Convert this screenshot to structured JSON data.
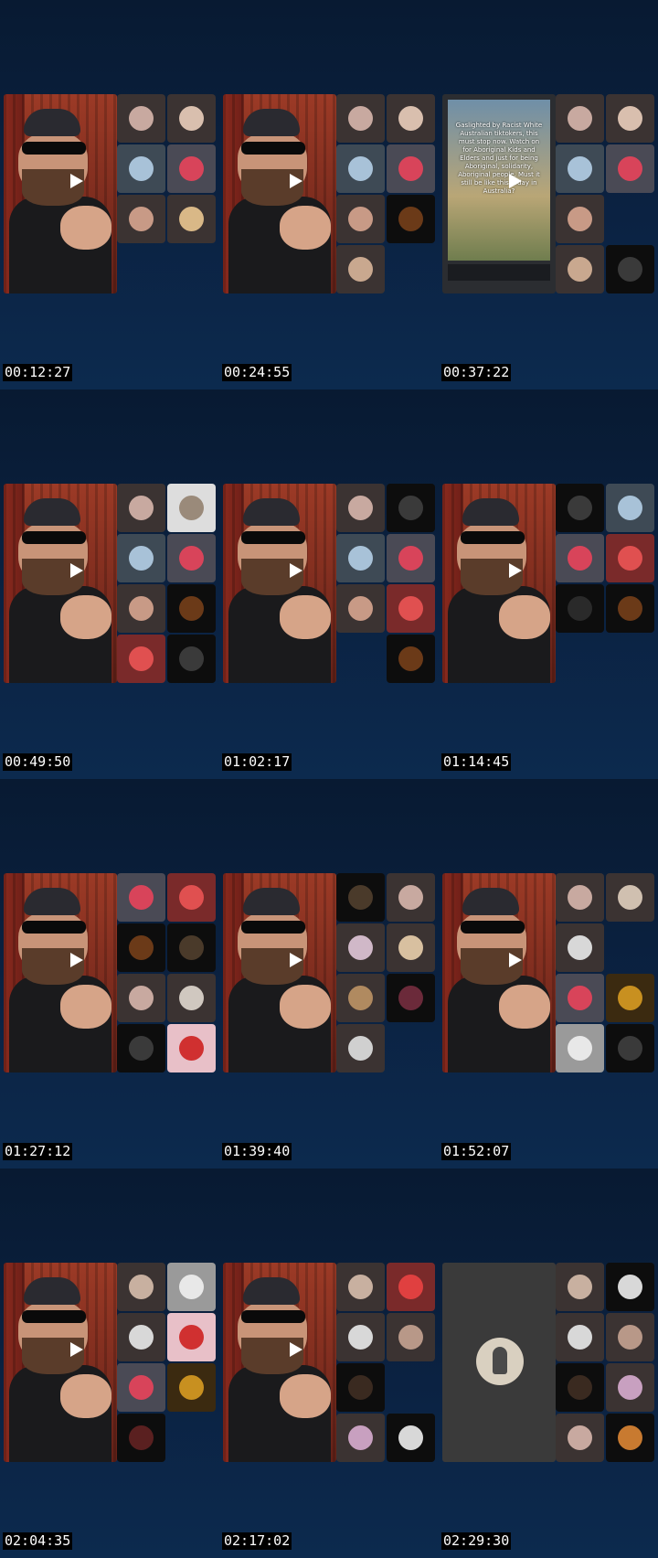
{
  "rows": [
    {
      "frames": [
        {
          "timestamp": "00:12:27",
          "main": "video",
          "tiles": [
            [
              "#3b3332",
              "#c8a9a0"
            ],
            [
              "#3b3332",
              "#d9bfae"
            ],
            [
              "#3e4a55",
              "#a8c2d8"
            ],
            [
              "#4a4a55",
              "#d8445a"
            ],
            [
              "#3b3332",
              "#c89a86"
            ],
            [
              "#3b3332",
              "#d9b887"
            ]
          ]
        },
        {
          "timestamp": "00:24:55",
          "main": "video",
          "tiles": [
            [
              "#3b3332",
              "#c8a9a0"
            ],
            [
              "#3b3332",
              "#d9bfae"
            ],
            [
              "#3e4a55",
              "#a8c2d8"
            ],
            [
              "#4a4a55",
              "#d8445a"
            ],
            [
              "#3b3332",
              "#c89a86"
            ],
            [
              "#0d0d0d",
              "#6b3a18"
            ],
            [
              "#3b3332",
              "#c9a88f"
            ]
          ]
        },
        {
          "timestamp": "00:37:22",
          "main": "phone",
          "tiles": [
            [
              "#3b3332",
              "#c8a9a0"
            ],
            [
              "#3b3332",
              "#d9bfae"
            ],
            [
              "#3e4a55",
              "#a8c2d8"
            ],
            [
              "#4a4a55",
              "#d8445a"
            ],
            [
              "#3b3332",
              "#c89a86"
            ],
            null,
            [
              "#3b3332",
              "#c9a88f"
            ],
            [
              "#0d0d0d",
              "#3a3a3a"
            ]
          ]
        }
      ]
    },
    {
      "frames": [
        {
          "timestamp": "00:49:50",
          "main": "video",
          "tiles": [
            [
              "#3b3332",
              "#c8a9a0"
            ],
            [
              "#dddddd",
              "#9a8a7a"
            ],
            [
              "#3e4a55",
              "#a8c2d8"
            ],
            [
              "#4a4a55",
              "#d8445a"
            ],
            [
              "#3b3332",
              "#c89a86"
            ],
            [
              "#0d0d0d",
              "#6b3a18"
            ],
            [
              "#7a2a2a",
              "#e05050"
            ],
            [
              "#0d0d0d",
              "#3a3a3a"
            ]
          ]
        },
        {
          "timestamp": "01:02:17",
          "main": "video",
          "tiles": [
            [
              "#3b3332",
              "#c8a9a0"
            ],
            [
              "#0d0d0d",
              "#3a3a3a"
            ],
            [
              "#3e4a55",
              "#a8c2d8"
            ],
            [
              "#4a4a55",
              "#d8445a"
            ],
            [
              "#3b3332",
              "#c89a86"
            ],
            [
              "#7a2a2a",
              "#e05050"
            ],
            null,
            [
              "#0d0d0d",
              "#6b3a18"
            ]
          ]
        },
        {
          "timestamp": "01:14:45",
          "main": "video",
          "tiles": [
            [
              "#0d0d0d",
              "#3a3a3a"
            ],
            [
              "#3e4a55",
              "#a8c2d8"
            ],
            [
              "#4a4a55",
              "#d8445a"
            ],
            [
              "#7a2a2a",
              "#e05050"
            ],
            [
              "#0d0d0d",
              "#2a2a2a"
            ],
            [
              "#0d0d0d",
              "#6b3a18"
            ]
          ]
        }
      ]
    },
    {
      "frames": [
        {
          "timestamp": "01:27:12",
          "main": "video",
          "tiles": [
            [
              "#4a4a55",
              "#d8445a"
            ],
            [
              "#7a2a2a",
              "#e05050"
            ],
            [
              "#0d0d0d",
              "#6b3a18"
            ],
            [
              "#0d0d0d",
              "#4a3a2a"
            ],
            [
              "#3b3332",
              "#c8a9a0"
            ],
            [
              "#3b3332",
              "#d0c8c0"
            ],
            [
              "#0d0d0d",
              "#3a3a3a"
            ],
            [
              "#e8c0c8",
              "#d03030"
            ]
          ]
        },
        {
          "timestamp": "01:39:40",
          "main": "video",
          "tiles": [
            [
              "#0d0d0d",
              "#4a3a2a"
            ],
            [
              "#3b3332",
              "#c8a9a0"
            ],
            [
              "#3b3332",
              "#d0b8c8"
            ],
            [
              "#3b3332",
              "#d8c0a0"
            ],
            [
              "#3b3332",
              "#b08a60"
            ],
            [
              "#0d0d0d",
              "#6b2a3a"
            ],
            [
              "#3b3332",
              "#d0d0d0"
            ]
          ]
        },
        {
          "timestamp": "01:52:07",
          "main": "video",
          "tiles": [
            [
              "#3b3332",
              "#c8a9a0"
            ],
            [
              "#3b3332",
              "#d0c0b0"
            ],
            [
              "#3b3332",
              "#d8d8d8"
            ],
            null,
            [
              "#4a4a55",
              "#d8445a"
            ],
            [
              "#3b2a10",
              "#c89020"
            ],
            [
              "#9a9a9a",
              "#e8e8e8"
            ],
            [
              "#0d0d0d",
              "#3a3a3a"
            ]
          ]
        }
      ]
    },
    {
      "frames": [
        {
          "timestamp": "02:04:35",
          "main": "video",
          "tiles": [
            [
              "#3b3332",
              "#c8b0a0"
            ],
            [
              "#9a9a9a",
              "#e8e8e8"
            ],
            [
              "#3b3332",
              "#d8d8d8"
            ],
            [
              "#e8c0c8",
              "#d03030"
            ],
            [
              "#4a4a55",
              "#d8445a"
            ],
            [
              "#3b2a10",
              "#c89020"
            ],
            [
              "#0d0d0d",
              "#5a2020"
            ]
          ]
        },
        {
          "timestamp": "02:17:02",
          "main": "video",
          "tiles": [
            [
              "#3b3332",
              "#c8b0a0"
            ],
            [
              "#7a2a2a",
              "#e04040"
            ],
            [
              "#3b3332",
              "#d8d8d8"
            ],
            [
              "#3b3332",
              "#b89888"
            ],
            [
              "#0d0d0d",
              "#3a2a20"
            ],
            null,
            [
              "#3b3332",
              "#c8a0c0"
            ],
            [
              "#0d0d0d",
              "#d8d8d8"
            ]
          ]
        },
        {
          "timestamp": "02:29:30",
          "main": "grey",
          "tiles": [
            [
              "#3b3332",
              "#c8b0a0"
            ],
            [
              "#0d0d0d",
              "#d8d8d8"
            ],
            [
              "#3b3332",
              "#d8d8d8"
            ],
            [
              "#3b3332",
              "#b89888"
            ],
            [
              "#0d0d0d",
              "#3a2a20"
            ],
            [
              "#3b3332",
              "#c8a0c0"
            ],
            [
              "#3b3332",
              "#c8a9a0"
            ],
            [
              "#0d0d0d",
              "#c87a30"
            ]
          ]
        }
      ]
    }
  ],
  "phone_text": "Gaslighted by Racist White Australian tiktokers, this must stop now. Watch on for Aboriginal Kids and Elders and just for being Aboriginal, solidarity, Aboriginal people. Must it still be like this today in Australia?"
}
